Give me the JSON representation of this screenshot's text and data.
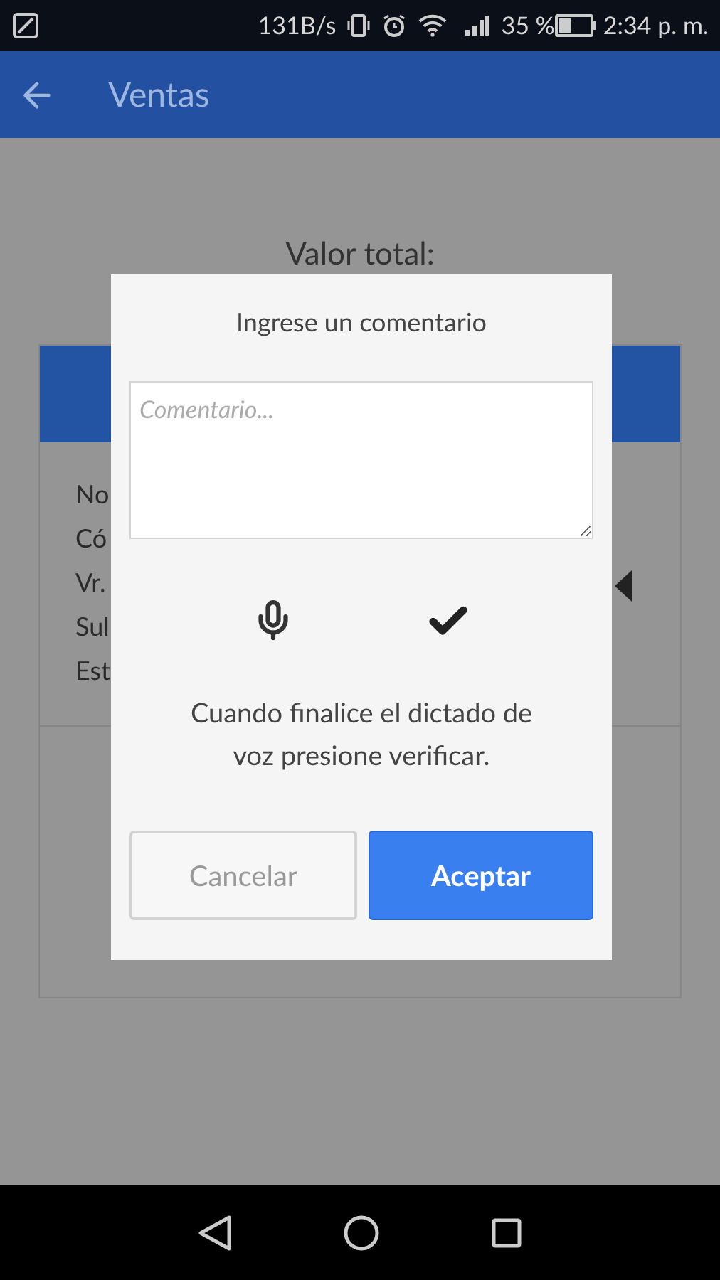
{
  "status_bar": {
    "speed": "131B/s",
    "battery": "35 %",
    "time": "2:34 p. m."
  },
  "app_bar": {
    "title": "Ventas"
  },
  "summary": {
    "label": "Valor total:"
  },
  "card": {
    "fields": [
      "No",
      "Có",
      "Vr.",
      "Sul",
      "Est"
    ]
  },
  "dialog": {
    "title": "Ingrese un comentario",
    "comment": {
      "placeholder": "Comentario..."
    },
    "hint": "Cuando finalice el dictado de voz presione verificar.",
    "buttons": [
      {
        "label": "Cancelar",
        "kind": "secondary"
      },
      {
        "label": "Aceptar",
        "kind": "primary"
      }
    ]
  }
}
